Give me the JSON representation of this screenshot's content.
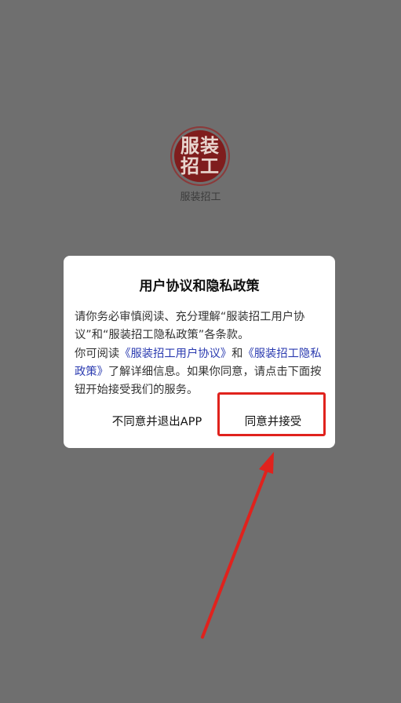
{
  "app": {
    "logo_chars": [
      "服装",
      "招工"
    ],
    "name": "服装招工"
  },
  "dialog": {
    "title": "用户协议和隐私政策",
    "body": {
      "p1": "请你务必审慎阅读、充分理解“服装招工用户协议”和“服装招工隐私政策”各条款。",
      "p2_prefix": "你可阅读",
      "link_user_agreement": "《服装招工用户协议》",
      "p2_and": "和",
      "link_privacy_policy": "《服装招工隐私政策》",
      "p2_suffix": "了解详细信息。如果你同意，请点击下面按钮开始接受我们的服务。"
    },
    "buttons": {
      "decline": "不同意并退出APP",
      "accept": "同意并接受"
    }
  },
  "colors": {
    "overlay": "#6f6f6f",
    "link": "#2b3bb0",
    "annotation": "#e0221d",
    "logo": "#7f1d1d"
  }
}
